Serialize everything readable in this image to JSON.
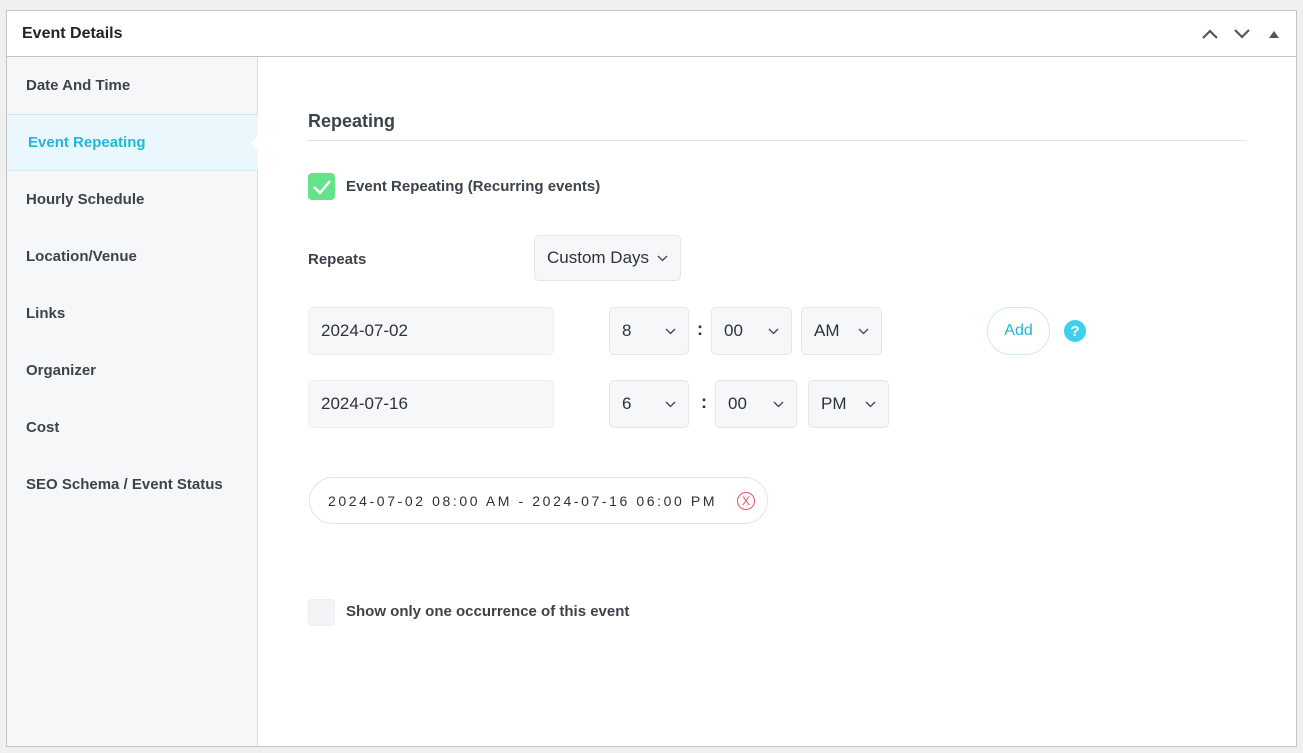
{
  "header": {
    "title": "Event Details",
    "icons": [
      "chevron-up-icon",
      "chevron-down-icon",
      "caret-up-icon"
    ]
  },
  "sidebar": {
    "items": [
      {
        "label": "Date And Time",
        "active": false
      },
      {
        "label": "Event Repeating",
        "active": true
      },
      {
        "label": "Hourly Schedule",
        "active": false
      },
      {
        "label": "Location/Venue",
        "active": false
      },
      {
        "label": "Links",
        "active": false
      },
      {
        "label": "Organizer",
        "active": false
      },
      {
        "label": "Cost",
        "active": false
      },
      {
        "label": "SEO Schema / Event Status",
        "active": false
      }
    ]
  },
  "main": {
    "section_title": "Repeating",
    "repeating_checkbox": {
      "label": "Event Repeating (Recurring events)",
      "checked": true
    },
    "repeats": {
      "label": "Repeats",
      "value": "Custom Days"
    },
    "start": {
      "date": "2024-07-02",
      "hour": "8",
      "minute": "00",
      "ampm": "AM"
    },
    "end": {
      "date": "2024-07-16",
      "hour": "6",
      "minute": "00",
      "ampm": "PM"
    },
    "time_separator": ":",
    "add_label": "Add",
    "help_glyph": "?",
    "ranges": [
      {
        "text": "2024-07-02 08:00 AM - 2024-07-16 06:00 PM",
        "remove_glyph": "X"
      }
    ],
    "one_occurrence_checkbox": {
      "label": "Show only one occurrence of this event",
      "checked": false
    }
  },
  "colors": {
    "accent": "#22b7d8",
    "checkbox_on": "#64e38a",
    "remove": "#f04d6a",
    "help": "#3fd0ee"
  }
}
